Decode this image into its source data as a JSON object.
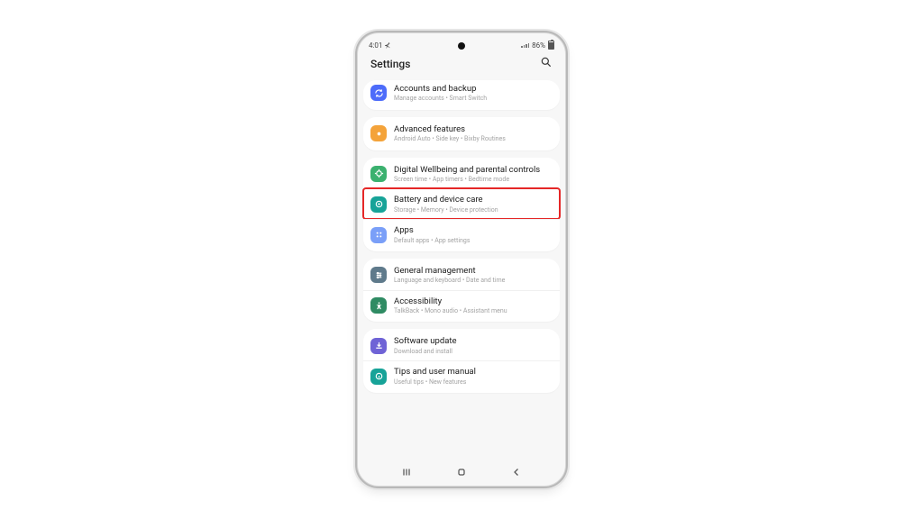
{
  "statusbar": {
    "time": "4:01",
    "location_indicator": "⊀",
    "battery": "86%"
  },
  "header": {
    "title": "Settings"
  },
  "groups": [
    {
      "items": [
        {
          "title": "Accounts and backup",
          "subtitle": "Manage accounts  •  Smart Switch"
        }
      ]
    },
    {
      "items": [
        {
          "title": "Advanced features",
          "subtitle": "Android Auto  •  Side key  •  Bixby Routines"
        }
      ]
    },
    {
      "items": [
        {
          "title": "Digital Wellbeing and parental controls",
          "subtitle": "Screen time  •  App timers  •  Bedtime mode"
        },
        {
          "title": "Battery and device care",
          "subtitle": "Storage  •  Memory  •  Device protection"
        },
        {
          "title": "Apps",
          "subtitle": "Default apps  •  App settings"
        }
      ]
    },
    {
      "items": [
        {
          "title": "General management",
          "subtitle": "Language and keyboard  •  Date and time"
        },
        {
          "title": "Accessibility",
          "subtitle": "TalkBack  •  Mono audio  •  Assistant menu"
        }
      ]
    },
    {
      "items": [
        {
          "title": "Software update",
          "subtitle": "Download and install"
        },
        {
          "title": "Tips and user manual",
          "subtitle": "Useful tips  •  New features"
        }
      ]
    }
  ]
}
